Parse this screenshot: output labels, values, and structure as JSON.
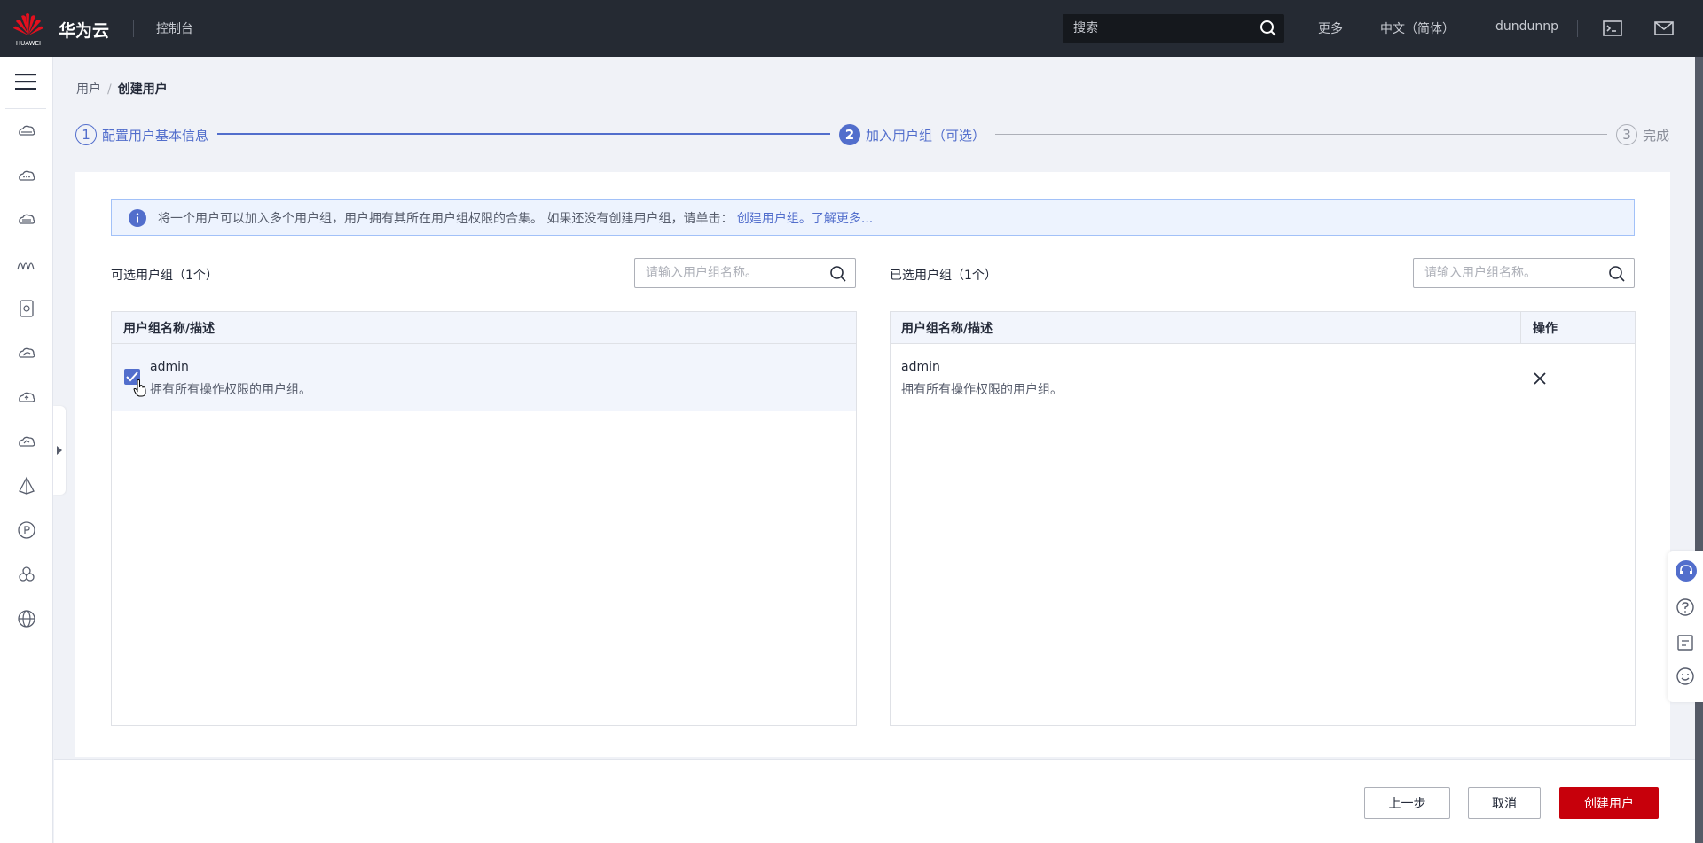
{
  "topbar": {
    "logo_text": "HUAWEI",
    "brand": "华为云",
    "console": "控制台",
    "search_placeholder": "搜索",
    "more": "更多",
    "language": "中文（简体）",
    "username": "dundunnp"
  },
  "breadcrumb": {
    "parent": "用户",
    "separator": "/",
    "current": "创建用户"
  },
  "steps": [
    {
      "num": "1",
      "label": "配置用户基本信息"
    },
    {
      "num": "2",
      "label": "加入用户组（可选）"
    },
    {
      "num": "3",
      "label": "完成"
    }
  ],
  "info": {
    "text": "将一个用户可以加入多个用户组，用户拥有其所在用户组权限的合集。 如果还没有创建用户组，请单击：",
    "create_link": "创建用户组。",
    "learn_link": "了解更多..."
  },
  "available": {
    "title": "可选用户组（1个）",
    "search_placeholder": "请输入用户组名称。",
    "header": "用户组名称/描述",
    "rows": [
      {
        "name": "admin",
        "desc": "拥有所有操作权限的用户组。",
        "checked": true
      }
    ]
  },
  "selected": {
    "title": "已选用户组（1个）",
    "search_placeholder": "请输入用户组名称。",
    "header": "用户组名称/描述",
    "op_header": "操作",
    "rows": [
      {
        "name": "admin",
        "desc": "拥有所有操作权限的用户组。"
      }
    ]
  },
  "footer": {
    "prev": "上一步",
    "cancel": "取消",
    "create": "创建用户"
  },
  "colors": {
    "accent": "#526ecc",
    "brand_red": "#c7000b",
    "topbar": "#252a33"
  }
}
